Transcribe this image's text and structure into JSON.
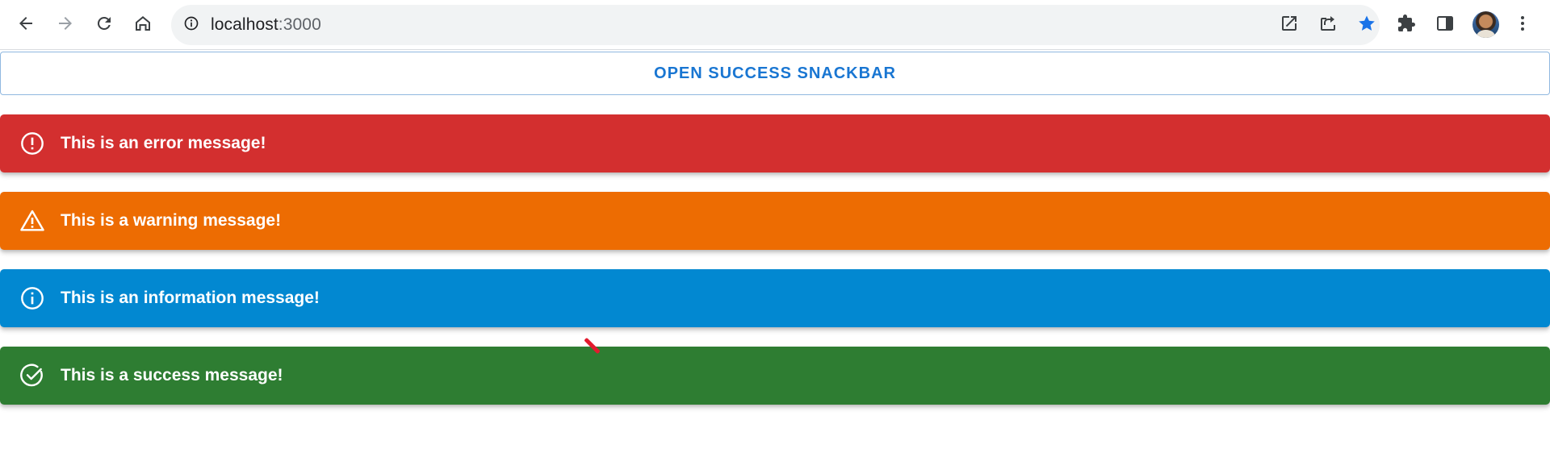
{
  "browser": {
    "url_host": "localhost",
    "url_port": ":3000",
    "icons": {
      "back": "arrow-left-icon",
      "forward": "arrow-right-icon",
      "reload": "reload-icon",
      "home": "home-icon",
      "info": "info-icon",
      "open_in_new": "open-in-new-icon",
      "share": "share-icon",
      "bookmark": "star-icon",
      "extensions": "puzzle-icon",
      "side_panel": "side-panel-icon",
      "profile": "avatar",
      "menu": "more-vert-icon"
    },
    "bookmark_color": "#1a73e8"
  },
  "page": {
    "open_button_label": "OPEN SUCCESS SNACKBAR",
    "alerts": [
      {
        "severity": "error",
        "message": "This is an error message!",
        "color": "#d32f2f",
        "icon": "error-outline-icon"
      },
      {
        "severity": "warning",
        "message": "This is a warning message!",
        "color": "#ed6c02",
        "icon": "warning-icon"
      },
      {
        "severity": "info",
        "message": "This is an information message!",
        "color": "#0288d1",
        "icon": "info-outline-icon"
      },
      {
        "severity": "success",
        "message": "This is a success message!",
        "color": "#2e7d32",
        "icon": "check-circle-outline-icon"
      }
    ]
  }
}
